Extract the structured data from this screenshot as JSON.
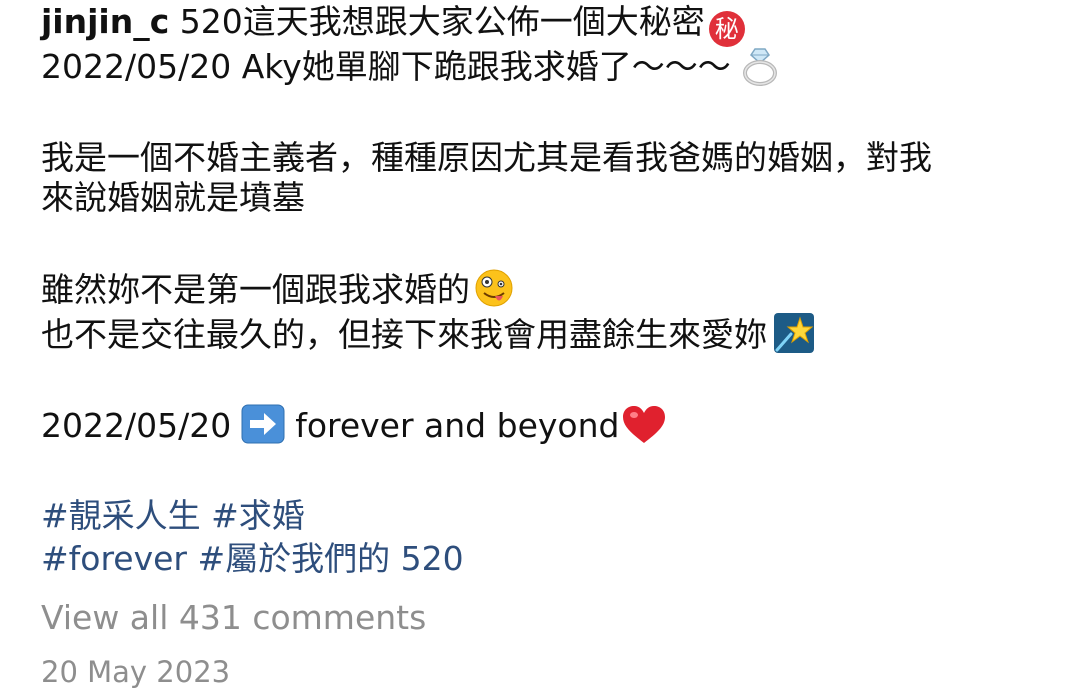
{
  "post": {
    "username": "jinjin_c",
    "line1_text": " 520這天我想跟大家公佈一個大秘密",
    "secret_badge": "秘",
    "line2_text": "2022/05/20 Aky她單腳下跪跟我求婚了～～～",
    "line3_text": "我是一個不婚主義者，種種原因尤其是看我爸媽的婚姻，對我",
    "line4_text": "來說婚姻就是墳墓",
    "line5_text": "雖然妳不是第一個跟我求婚的",
    "line6_text": "也不是交往最久的，但接下來我會用盡餘生來愛妳",
    "line7_date": "2022/05/20",
    "line7_text": "forever and beyond",
    "hashtags_line1": "#靚采人生 #求婚",
    "hashtags_line2": "#forever #屬於我們的 520"
  },
  "comments": {
    "view_all_label": "View all 431 comments"
  },
  "timestamp": "20 May 2023",
  "icons": {
    "secret": "secret-ideograph-icon",
    "ring": "ring-icon",
    "zany_face": "zany-face-icon",
    "star": "shooting-star-icon",
    "arrow": "right-arrow-icon",
    "heart": "red-heart-icon"
  },
  "colors": {
    "text": "#111111",
    "hashtag": "#2e4e7c",
    "muted": "#8e8e8e",
    "badge_red": "#e0303a"
  }
}
